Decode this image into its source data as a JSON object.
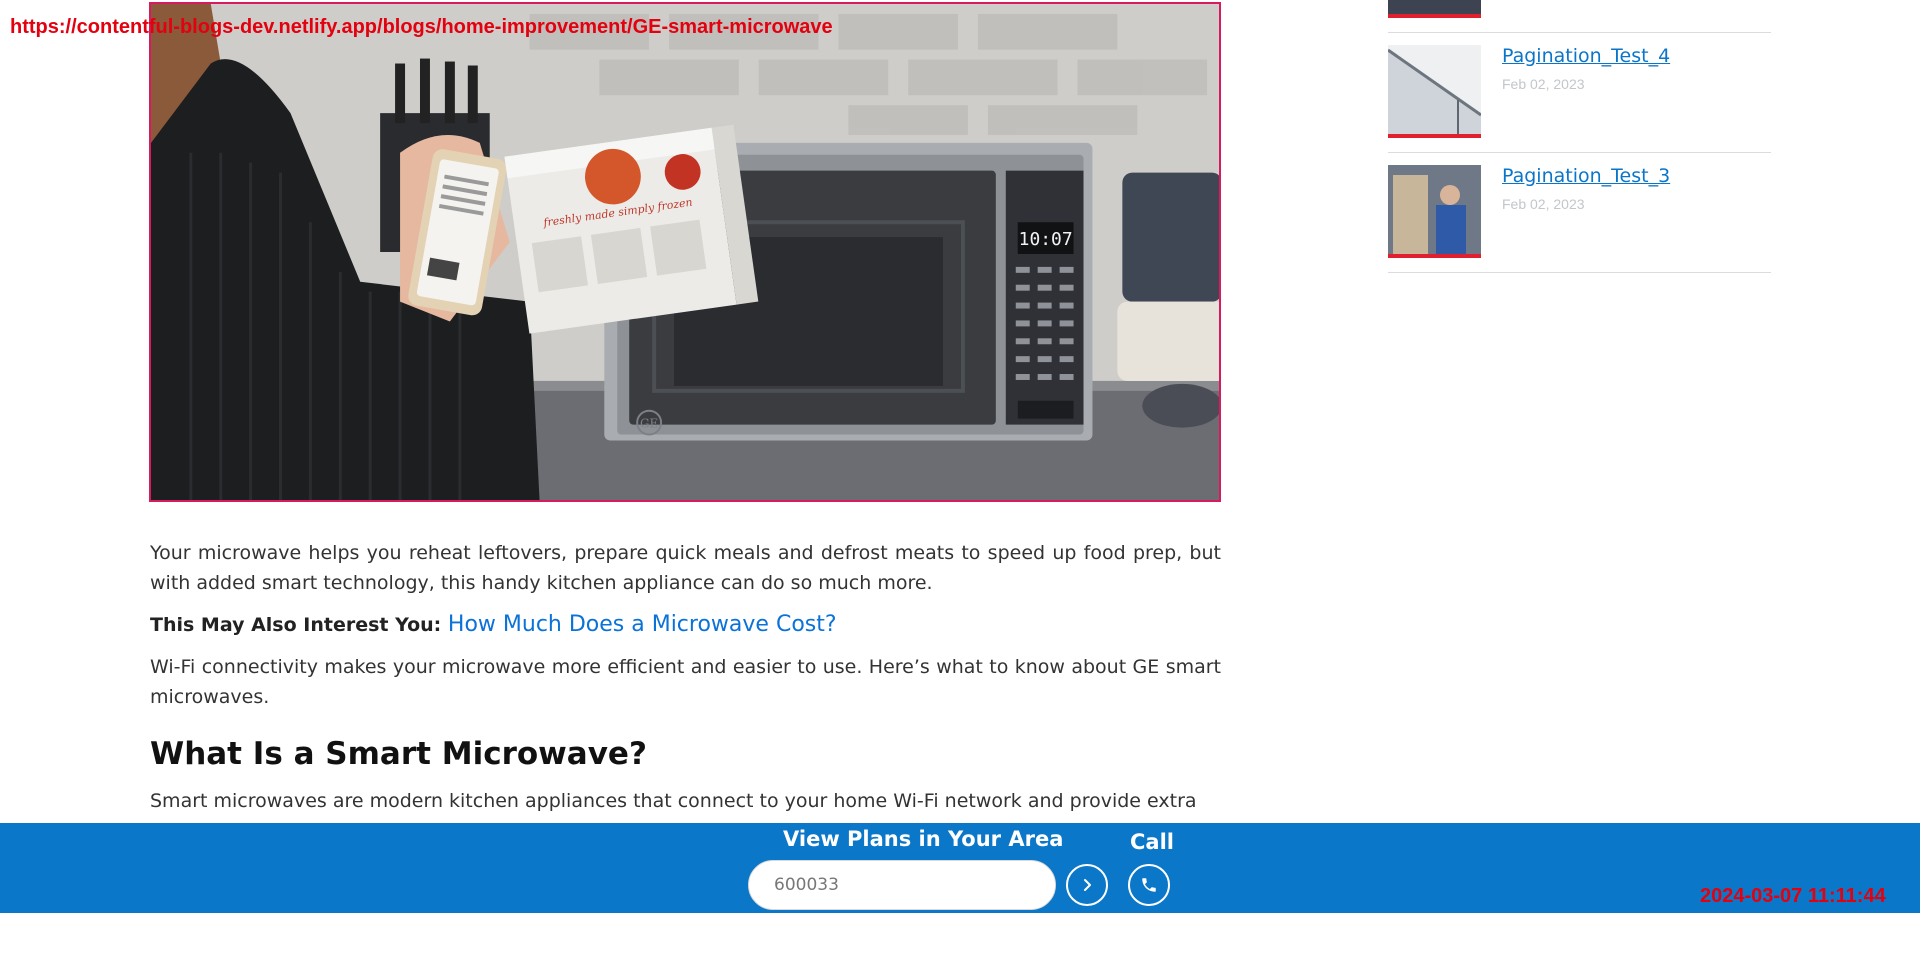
{
  "browser_overlay": {
    "url": "https://contentful-blogs-dev.netlify.app/blogs/home-improvement/GE-smart-microwave",
    "timestamp": "2024-03-07 11:11:44"
  },
  "hero": {
    "display_time": "10:07",
    "brand_logo": "GE",
    "package_text": "freshly made simply frozen"
  },
  "article": {
    "intro": "Your microwave helps you reheat leftovers, prepare quick meals and defrost meats to speed up food prep, but with added smart technology, this handy kitchen appliance can do so much more.",
    "interest_label": "This May Also Interest You: ",
    "interest_link": "How Much Does a Microwave Cost?",
    "wifi_paragraph": "Wi-Fi connectivity makes your microwave more efficient and easier to use. Here’s what to know about GE smart microwaves.",
    "heading": "What Is a Smart Microwave?",
    "smart_paragraph": "Smart microwaves are modern kitchen appliances that connect to your home Wi-Fi network and provide extra"
  },
  "sidebar": {
    "items": [
      {
        "title": "Pagination_Test_4",
        "date": "Feb 02, 2023"
      },
      {
        "title": "Pagination_Test_3",
        "date": "Feb 02, 2023"
      }
    ]
  },
  "cta": {
    "title": "View Plans in Your Area",
    "zip_value": "600033",
    "call_label": "Call"
  },
  "colors": {
    "accent_blue": "#0b77c9",
    "link_blue": "#0a72d8",
    "overlay_red": "#e3000f",
    "thumb_border": "#e0202e"
  },
  "icons": [
    "chevron-right-icon",
    "phone-icon",
    "ge-logo-icon"
  ]
}
